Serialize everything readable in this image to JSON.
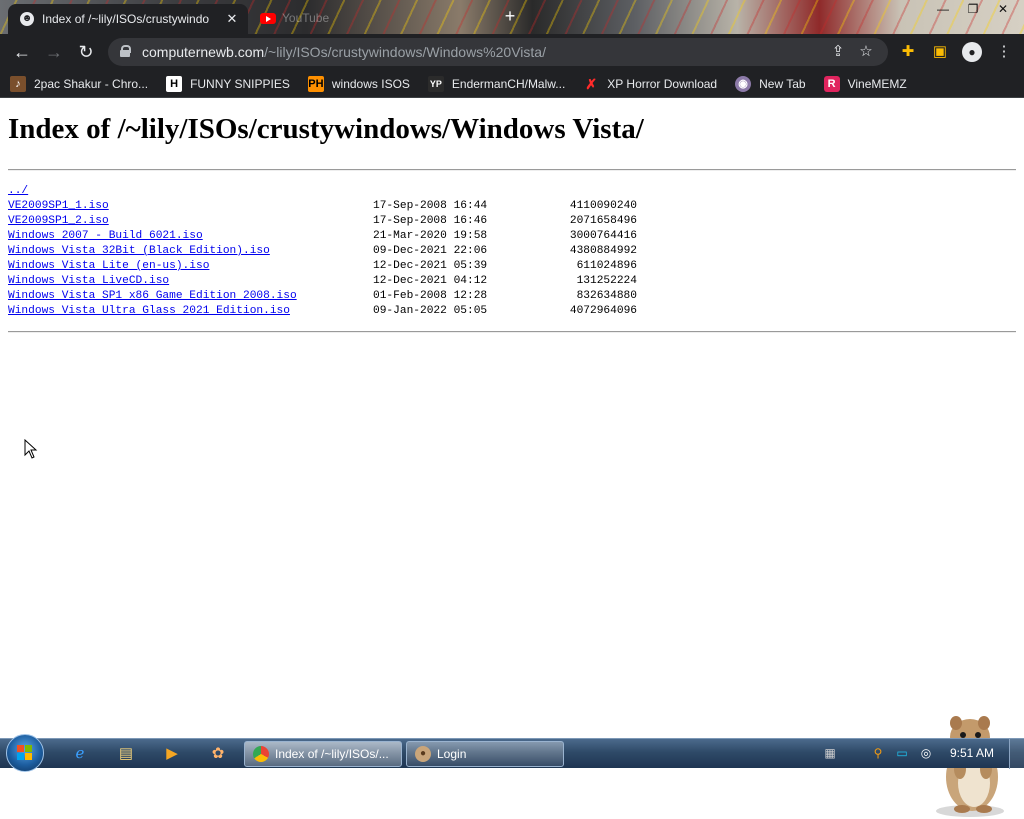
{
  "browser": {
    "active_tab": {
      "title": "Index of /~lily/ISOs/crustywindo"
    },
    "inactive_tab": {
      "title": "YouTube"
    },
    "address": {
      "host": "computernewb.com",
      "path": "/~lily/ISOs/crustywindows/Windows%20Vista/"
    },
    "bookmarks": [
      {
        "label": "2pac Shakur - Chro...",
        "icon": "2pac-favicon"
      },
      {
        "label": "FUNNY SNIPPIES",
        "icon": "h-favicon"
      },
      {
        "label": "windows ISOS",
        "icon": "ph-favicon"
      },
      {
        "label": "EndermanCH/Malw...",
        "icon": "yp-favicon"
      },
      {
        "label": "XP Horror Download",
        "icon": "x-favicon"
      },
      {
        "label": "New Tab",
        "icon": "globe-favicon"
      },
      {
        "label": "VineMEMZ",
        "icon": "r-favicon"
      }
    ]
  },
  "page": {
    "heading": "Index of /~lily/ISOs/crustywindows/Windows Vista/",
    "parent_link": "../",
    "files": [
      {
        "name": "VE2009SP1_1.iso",
        "date": "17-Sep-2008 16:44",
        "size": "4110090240"
      },
      {
        "name": "VE2009SP1_2.iso",
        "date": "17-Sep-2008 16:46",
        "size": "2071658496"
      },
      {
        "name": "Windows 2007 - Build 6021.iso",
        "date": "21-Mar-2020 19:58",
        "size": "3000764416"
      },
      {
        "name": "Windows Vista 32Bit (Black Edition).iso",
        "date": "09-Dec-2021 22:06",
        "size": "4380884992"
      },
      {
        "name": "Windows Vista Lite (en-us).iso",
        "date": "12-Dec-2021 05:39",
        "size": "611024896"
      },
      {
        "name": "Windows Vista LiveCD.iso",
        "date": "12-Dec-2021 04:12",
        "size": "131252224"
      },
      {
        "name": "Windows Vista SP1 x86 Game Edition 2008.iso",
        "date": "01-Feb-2008 12:28",
        "size": "832634880"
      },
      {
        "name": "Windows Vista Ultra Glass 2021 Edition.iso",
        "date": "09-Jan-2022 05:05",
        "size": "4072964096"
      }
    ]
  },
  "taskbar": {
    "tasks": [
      {
        "label": "Index of /~lily/ISOs/...",
        "icon": "chrome-icon"
      },
      {
        "label": "Login",
        "icon": "hamster-icon"
      }
    ],
    "clock": "9:51 AM"
  },
  "colors": {
    "link": "#0000ee",
    "chrome_dark": "#202124",
    "taskbar": "#2f4a68"
  }
}
